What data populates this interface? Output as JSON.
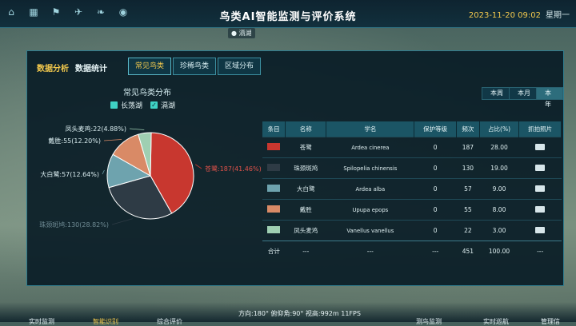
{
  "header": {
    "title": "鸟类AI智能监测与评价系统",
    "datetime": "2023-11-20 09:02",
    "weekday": "星期一"
  },
  "map": {
    "search_chip": "滆湖"
  },
  "panel": {
    "section_label": "数据分析",
    "sub_label": "数据统计",
    "tabs": [
      {
        "label": "常见鸟类",
        "active": true
      },
      {
        "label": "珍稀鸟类",
        "active": false
      },
      {
        "label": "区域分布",
        "active": false
      }
    ],
    "chart_title": "常见鸟类分布",
    "legend": [
      {
        "label": "长荡湖"
      },
      {
        "label": "滆湖"
      }
    ],
    "periods": [
      {
        "label": "本周"
      },
      {
        "label": "本月"
      },
      {
        "label": "本年",
        "active": true
      }
    ],
    "table": {
      "headers": [
        "条目",
        "名称",
        "学名",
        "保护等级",
        "频次",
        "占比(%)",
        "抓拍照片"
      ],
      "rows": [
        {
          "color": "#c8372f",
          "name": "苍鹭",
          "sci": "Ardea cinerea",
          "level": "0",
          "freq": "187",
          "pct": "28.00"
        },
        {
          "color": "#2e3b45",
          "name": "珠颈斑鸠",
          "sci": "Spilopelia chinensis",
          "level": "0",
          "freq": "130",
          "pct": "19.00"
        },
        {
          "color": "#6ea3ae",
          "name": "大白鹭",
          "sci": "Ardea alba",
          "level": "0",
          "freq": "57",
          "pct": "9.00"
        },
        {
          "color": "#d98a66",
          "name": "戴胜",
          "sci": "Upupa epops",
          "level": "0",
          "freq": "55",
          "pct": "8.00"
        },
        {
          "color": "#9fcfb2",
          "name": "凤头麦鸡",
          "sci": "Vanellus vanellus",
          "level": "0",
          "freq": "22",
          "pct": "3.00"
        }
      ],
      "total": {
        "label": "合计",
        "name": "---",
        "sci": "---",
        "level": "---",
        "freq": "451",
        "pct": "100.00",
        "photo": "---"
      }
    }
  },
  "chart_data": {
    "type": "pie",
    "title": "常见鸟类分布",
    "categories": [
      "苍鹭",
      "珠颈斑鸠",
      "大白鹭",
      "戴胜",
      "凤头麦鸡"
    ],
    "values": [
      187,
      130,
      57,
      55,
      22
    ],
    "percentages": [
      41.46,
      28.82,
      12.64,
      12.2,
      4.88
    ],
    "labels": [
      "苍鹭:187(41.46%)",
      "珠颈斑鸠:130(28.82%)",
      "大白鹭:57(12.64%)",
      "戴胜:55(12.20%)",
      "凤头麦鸡:22(4.88%)"
    ],
    "colors": [
      "#c8372f",
      "#2e3b45",
      "#6ea3ae",
      "#d98a66",
      "#9fcfb2"
    ]
  },
  "statusbar": {
    "text": "方向:180°  俯仰角:90°  视高:992m    11FPS"
  },
  "bottom_nav": [
    {
      "label": "实时监测"
    },
    {
      "label": "智能识别",
      "active": true
    },
    {
      "label": "综合评价"
    },
    {
      "label": "测鸟监测"
    },
    {
      "label": "实时巡航"
    },
    {
      "label": "管理信"
    }
  ]
}
